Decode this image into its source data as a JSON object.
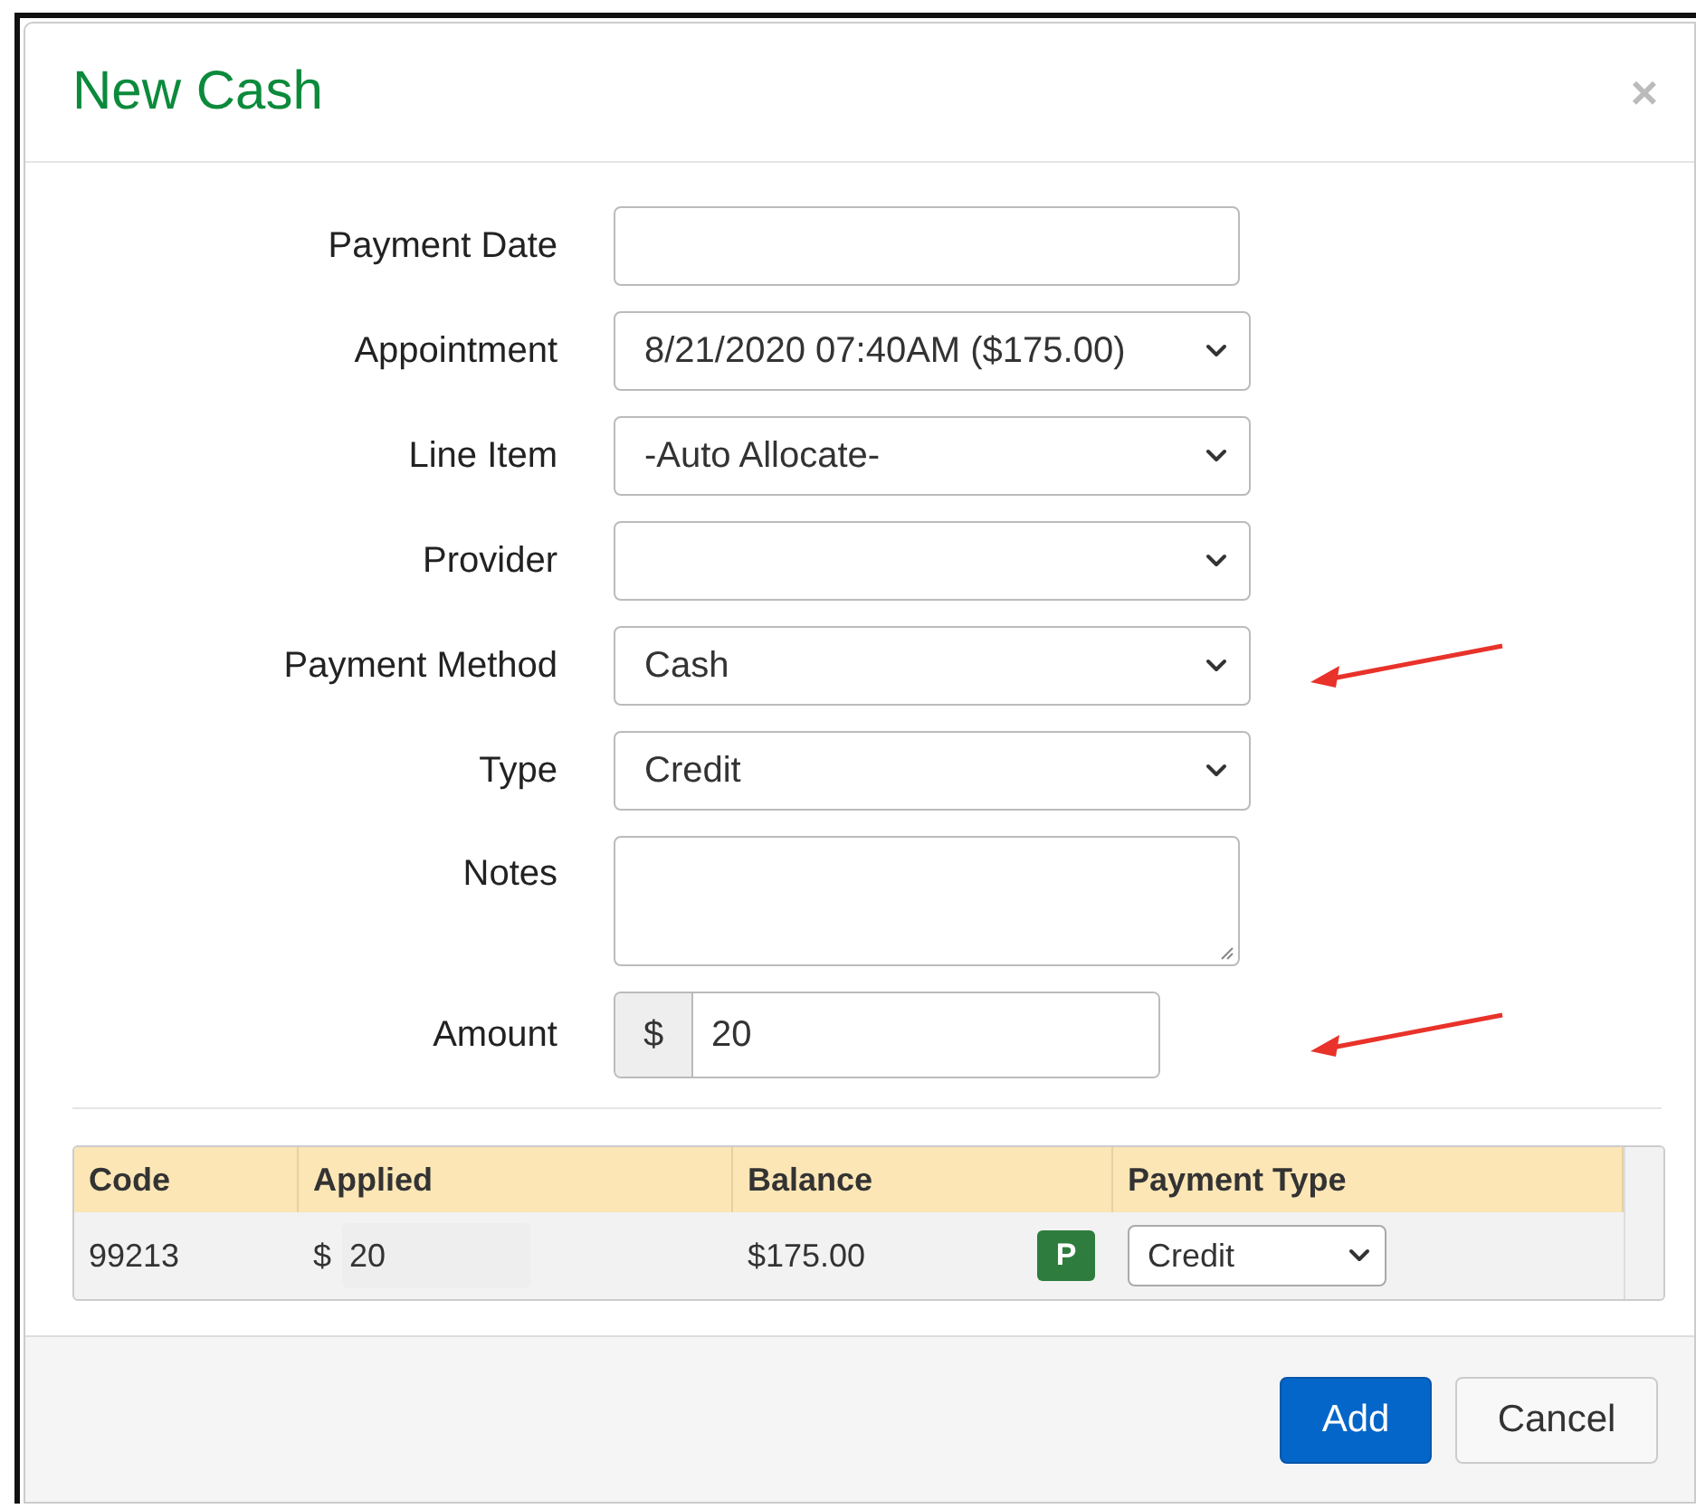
{
  "dialog": {
    "title": "New Cash",
    "close": "×"
  },
  "fields": [
    {
      "kind": "text",
      "label": "Payment Date"
    },
    {
      "kind": "select",
      "label": "Appointment",
      "value": "8/21/2020 07:40AM ($175.00)"
    },
    {
      "kind": "select",
      "label": "Line Item",
      "value": "-Auto Allocate-"
    },
    {
      "kind": "select",
      "label": "Provider"
    },
    {
      "kind": "select",
      "label": "Payment Method",
      "value": "Cash"
    },
    {
      "kind": "select",
      "label": "Type",
      "value": "Credit"
    },
    {
      "kind": "textarea",
      "label": "Notes"
    },
    {
      "kind": "currency",
      "label": "Amount",
      "prefix": "$",
      "value": "20"
    }
  ],
  "table": {
    "columns": [
      "Code",
      "Applied",
      "Balance",
      "Payment Type"
    ],
    "rows": [
      {
        "code": "99213",
        "applied_prefix": "$",
        "applied": "20",
        "balance": "$175.00",
        "badge": "P",
        "payment_type": "Credit"
      }
    ]
  },
  "buttons": [
    {
      "label": "Add",
      "kind": "primary"
    },
    {
      "label": "Cancel",
      "kind": "default"
    }
  ]
}
